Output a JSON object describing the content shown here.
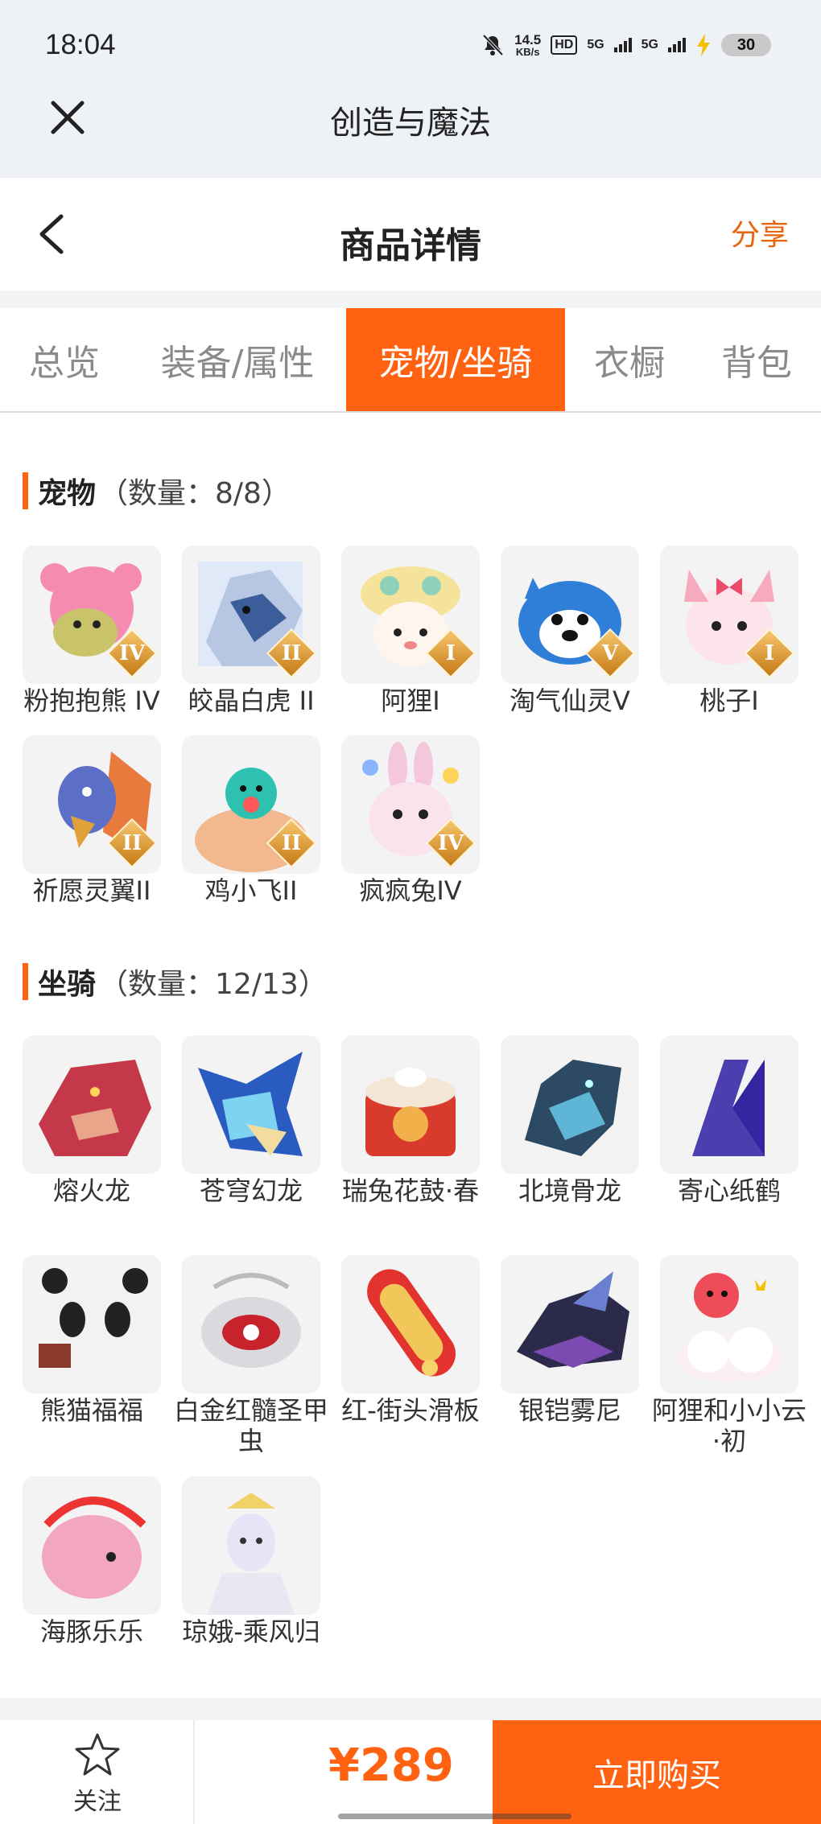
{
  "status_bar": {
    "time": "18:04",
    "net_speed": "14.5",
    "net_speed_unit": "KB/s",
    "hd": "HD",
    "sim1": "5G",
    "sim2": "5G",
    "battery": "30"
  },
  "app": {
    "title": "创造与魔法",
    "close_icon": "close-icon"
  },
  "header": {
    "title": "商品详情",
    "share_label": "分享",
    "back_icon": "chevron-left-icon"
  },
  "tabs": [
    {
      "label": "总览"
    },
    {
      "label": "装备/属性"
    },
    {
      "label": "宠物/坐骑",
      "active": true
    },
    {
      "label": "衣橱"
    },
    {
      "label": "背包"
    }
  ],
  "pets": {
    "title": "宠物",
    "count": "（数量：8/8）",
    "items": [
      {
        "name": "粉抱抱熊 IV",
        "tier": "IV"
      },
      {
        "name": "皎晶白虎 II",
        "tier": "II"
      },
      {
        "name": "阿狸I",
        "tier": "I"
      },
      {
        "name": "淘气仙灵V",
        "tier": "V"
      },
      {
        "name": "桃子I",
        "tier": "I"
      },
      {
        "name": "祈愿灵翼II",
        "tier": "II"
      },
      {
        "name": "鸡小飞II",
        "tier": "II"
      },
      {
        "name": "疯疯兔IV",
        "tier": "IV"
      }
    ]
  },
  "mounts": {
    "title": "坐骑",
    "count": "（数量：12/13）",
    "items": [
      {
        "name": "熔火龙"
      },
      {
        "name": "苍穹幻龙"
      },
      {
        "name": "瑞兔花鼓·春"
      },
      {
        "name": "北境骨龙"
      },
      {
        "name": "寄心纸鹤"
      },
      {
        "name": "熊猫福福"
      },
      {
        "name": "白金红髓圣甲虫"
      },
      {
        "name": "红-街头滑板"
      },
      {
        "name": "银铠雾尼"
      },
      {
        "name": "阿狸和小小云·初"
      },
      {
        "name": "海豚乐乐"
      },
      {
        "name": "琼娥-乘风归"
      }
    ]
  },
  "bottom_bar": {
    "follow_label": "关注",
    "follow_icon": "star-icon",
    "price": "¥289",
    "buy_label": "立即购买"
  },
  "colors": {
    "accent": "#ff6312",
    "share": "#e8640e",
    "topbar": "#eef2f7"
  }
}
